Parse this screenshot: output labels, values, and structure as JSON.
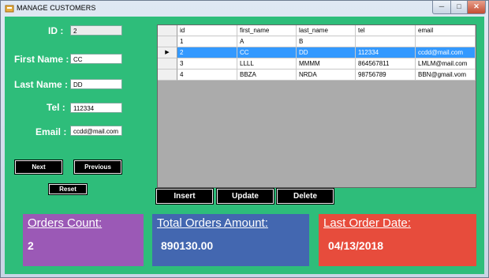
{
  "window": {
    "title": "MANAGE CUSTOMERS",
    "minimize": "─",
    "maximize": "□",
    "close": "✕"
  },
  "form": {
    "id": {
      "label": "ID :",
      "value": "2"
    },
    "first_name": {
      "label": "First Name :",
      "value": "CC"
    },
    "last_name": {
      "label": "Last Name :",
      "value": "DD"
    },
    "tel": {
      "label": "Tel :",
      "value": "112334"
    },
    "email": {
      "label": "Email :",
      "value": "ccdd@mail.com"
    }
  },
  "buttons": {
    "next": "Next",
    "previous": "Previous",
    "reset": "Reset",
    "insert": "Insert",
    "update": "Update",
    "delete": "Delete"
  },
  "grid": {
    "columns": [
      "id",
      "first_name",
      "last_name",
      "tel",
      "email"
    ],
    "current_row_marker": "▶",
    "rows": [
      [
        "1",
        "A",
        "B",
        "",
        ""
      ],
      [
        "2",
        "CC",
        "DD",
        "112334",
        "ccdd@mail.com"
      ],
      [
        "3",
        "LLLL",
        "MMMM",
        "864567811",
        "LMLM@mail.com"
      ],
      [
        "4",
        "BBZA",
        "NRDA",
        "98756789",
        "BBN@gmail.vom"
      ]
    ]
  },
  "stats": {
    "orders_count": {
      "label": "Orders Count:",
      "value": "2",
      "color": "#9b59b6"
    },
    "total_orders_amount": {
      "label": "Total Orders Amount:",
      "value": "890130.00",
      "color": "#4367b0"
    },
    "last_order_date": {
      "label": "Last Order Date:",
      "value": "04/13/2018",
      "color": "#e74c3c"
    }
  },
  "colors": {
    "background": "#2ebd7a",
    "selection": "#3399ff"
  }
}
